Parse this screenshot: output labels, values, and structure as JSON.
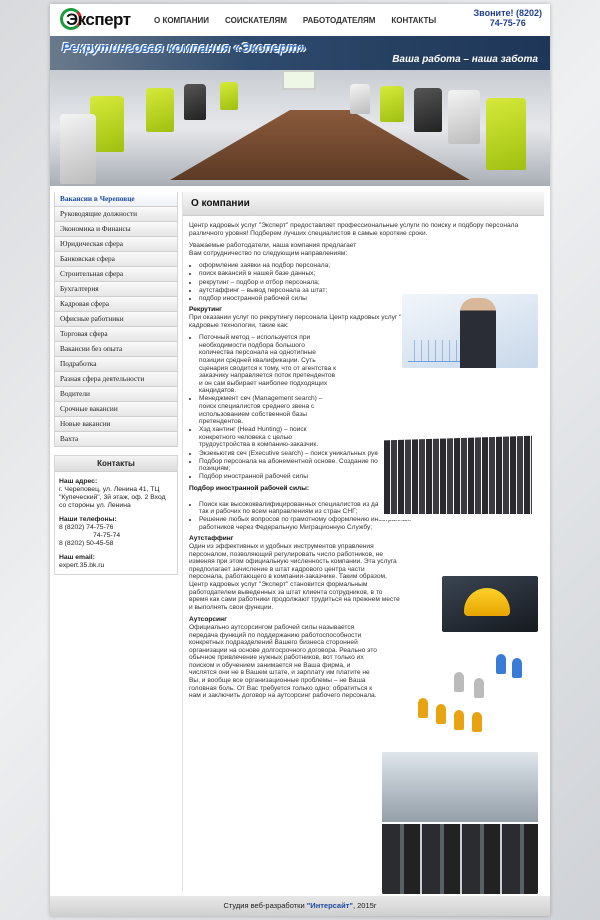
{
  "header": {
    "logo_text": "Эксперт",
    "nav": [
      "О КОМПАНИИ",
      "СОИСКАТЕЛЯМ",
      "РАБОТОДАТЕЛЯМ",
      "КОНТАКТЫ"
    ],
    "phone_label": "Звоните! (8202)",
    "phone_number": "74-75-76"
  },
  "banner": {
    "slogan": "Рекрутинговая компания «Эксперт»",
    "tagline": "Ваша работа – наша забота"
  },
  "sidebar": {
    "items": [
      "Вакансии в Череповце",
      "Руководящие должности",
      "Экономика и Финансы",
      "Юридическая сфера",
      "Банковская сфера",
      "Строительная сфера",
      "Бухгалтерия",
      "Кадровая сфера",
      "Офисные работники",
      "Торговая сфера",
      "Вакансии без опыта",
      "Подработка",
      "Разная сфера деятельности",
      "Водители",
      "Срочные вакансии",
      "Новые вакансии",
      "Вахта"
    ],
    "contacts": {
      "title": "Контакты",
      "address_title": "Наш адрес:",
      "address": "г. Череповец, ул. Ленина 41, ТЦ \"Купеческий\", 3й этаж, оф. 2 Вход со стороны ул. Ленина",
      "phones_title": "Наши телефоны:",
      "phone1": "8 (8202) 74-75-76",
      "phone2": "74-75-74",
      "phone3": "8 (8202) 50-45-58",
      "email_title": "Наш email:",
      "email": "expert.35.bk.ru"
    }
  },
  "main": {
    "title": "О компании",
    "intro": "Центр кадровых услуг \"Эксперт\" предоставляет профессиональные услуги по поиску и подбору персонала различного уровня! Подберем лучших специалистов в самые короткие сроки.",
    "employers_intro": "Уважаемые работодатели, наша компания предлагает Вам сотрудничество по следующим направлениям:",
    "directions": [
      "оформление заявки на подбор персонала;",
      "поиск вакансий в нашей базе данных;",
      "рекрутинг – подбор и отбор персонала;",
      "аутстаффинг – вывод персонала за штат;",
      "подбор иностранной рабочей силы"
    ],
    "recruiting_title": "Рекрутинг",
    "recruiting_intro": "При оказании услуг по рекрутингу персонала Центр кадровых услуг \"Эксперт\" использует современные кадровые технологии, такие как:",
    "recruiting_items": [
      "Поточный метод – используется при необходимости подбора большого количества персонала на однотипные позиции средней квалификации. Суть сценария сводится к тому, что от агентства к заказчику направляется поток претендентов и он сам выбирает наиболее подходящих кандидатов.",
      "Менеджмент сеч (Management search) – поиск специалистов среднего звена с использованием собственной базы претендентов.",
      "Хэд хантинг (Head Hunting) – поиск конкретного человека с целью трудоустройства в компанию-заказчик.",
      "Экзекьютив сеч (Executive search) – поиск уникальных руководителей.",
      "Подбор персонала на абонементной основе. Создание постоянного подлора кадров по определенным позициям;",
      "Подбор иностранной рабочей силы"
    ],
    "foreign_title": "Подбор иностранной рабочей силы:",
    "foreign_items": [
      "Поиск как высококвалифицированных специалистов из дальнего зарубежья, так и рабочих по всем направлениям из стран СНГ;",
      "Решение любых вопросов по грамотному оформлению иностранных работников через Федеральную Миграционную Службу;"
    ],
    "outstaff_title": "Аутстаффинг",
    "outstaff_text": "Один из эффективных и удобных инструментов управления персоналом, позволяющий регулировать число работников, не изменяя при этом официальную численность компании. Эта услуга предполагает зачисление в штат кадрового центра части персонала, работающего в компании-заказчике. Таким образом, Центр кадровых услуг \"Эксперт\" становится формальным работодателем выведенных за штат клиента сотрудников, в то время как сами работники продолжают трудиться на прежнем месте и выполнять свои функции.",
    "outsourcing_title": "Аутсорсинг",
    "outsourcing_text": "Официально аутсорсингом рабочей силы называется передача функций по поддержанию работоспособности конкретных подразделений Вашего бизнеса сторонней организации на основе долгосрочного договора. Реально это обычное привлечение нужных работников, вот только их поиском и обучением занимается не Ваша фирма, и числятся они не в Вашем штате, и зарплату им платите не Вы, и вообще все организационные проблемы – не Ваша головная боль. От Вас требуется только одно: обратиться к нам и заключить договор на аутсорсинг рабочего персонала."
  },
  "footer": {
    "prefix": "Студия веб-разработки",
    "studio": "\"Интерсайт\"",
    "suffix": ", 2015г"
  }
}
